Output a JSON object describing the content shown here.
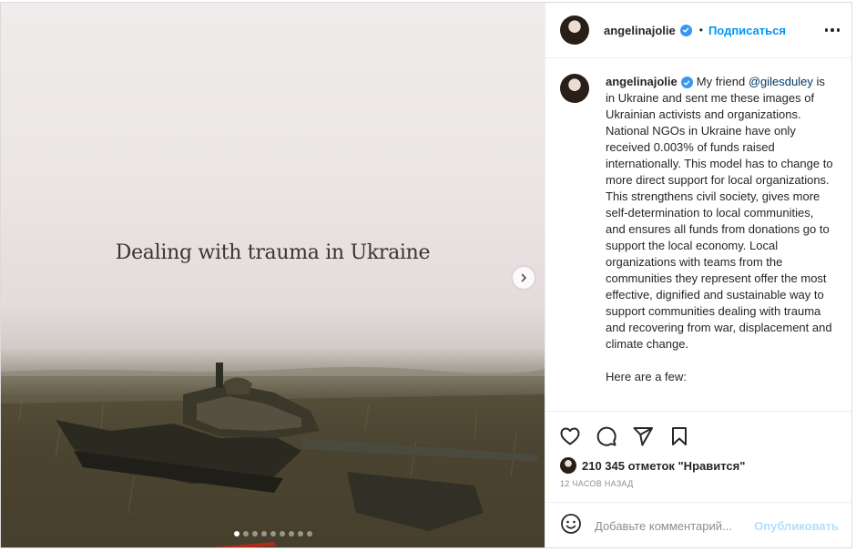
{
  "media": {
    "overlay_title": "Dealing with trauma in Ukraine",
    "slide_count": 9,
    "active_slide_index": 0
  },
  "header": {
    "username": "angelinajolie",
    "separator": "•",
    "follow_label": "Подписаться"
  },
  "caption": {
    "username": "angelinajolie",
    "before_mention": "My friend",
    "mention": "@gilesduley",
    "body": "is in Ukraine and sent me these images of Ukrainian activists and organizations. National NGOs in Ukraine have only received 0.003% of funds raised internationally. This model has to change to more direct support for local organizations. This strengthens civil society, gives more self-determination to local communities, and ensures all funds from donations go to support the local economy. Local organizations with teams from the communities they represent offer the most effective, dignified and sustainable way to support communities dealing with trauma and recovering from war, displacement and climate change.",
    "continuation": "Here are a few:"
  },
  "actions": {
    "likes_label": "210 345 отметок \"Нравится\"",
    "time_label": "12 ЧАСОВ НАЗАД"
  },
  "comment": {
    "placeholder": "Добавьте комментарий...",
    "publish_label": "Опубликовать"
  },
  "colors": {
    "accent": "#0095f6",
    "verified": "#3897f0",
    "publish_disabled": "#b2dffc",
    "text": "#262626",
    "muted": "#8e8e8e"
  },
  "icons": [
    "more-icon",
    "verified-icon",
    "heart-icon",
    "comment-icon",
    "share-icon",
    "bookmark-icon",
    "emoji-icon",
    "chevron-right-icon"
  ]
}
